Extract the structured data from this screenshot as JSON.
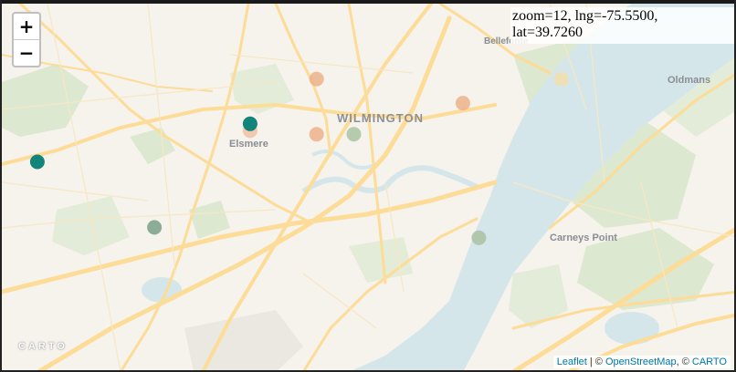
{
  "map": {
    "zoom_in_label": "+",
    "zoom_out_label": "−",
    "info_line1": "zoom=12, lng=-75.5500,",
    "info_line2": "lat=39.7260",
    "places": {
      "wilmington": "WILMINGTON",
      "elsmere": "Elsmere",
      "bellefonte": "Bellefonte",
      "oldmans": "Oldmans",
      "carneys_point": "Carneys Point"
    },
    "basemap_logo": "CARTO",
    "attribution": {
      "leaflet": "Leaflet",
      "sep1": " | © ",
      "osm": "OpenStreetMap",
      "sep2": ", © ",
      "carto": "CARTO"
    },
    "colors": {
      "teal": "#12857b",
      "sage": "#7fa58e",
      "olive": "#a6bf9f",
      "peach": "#ecae85",
      "pale_yellow": "#f4dea6",
      "water": "#d7e7ea",
      "park": "#dce8d0",
      "road": "#fcdc97"
    },
    "markers": [
      {
        "lng": -75.595,
        "lat": 39.744,
        "color": "teal",
        "opacity": 1.0
      },
      {
        "lng": -75.675,
        "lat": 39.733,
        "color": "teal",
        "opacity": 1.0
      },
      {
        "lng": -75.631,
        "lat": 39.714,
        "color": "sage",
        "opacity": 0.9
      },
      {
        "lng": -75.556,
        "lat": 39.741,
        "color": "olive",
        "opacity": 0.8
      },
      {
        "lng": -75.509,
        "lat": 39.711,
        "color": "olive",
        "opacity": 0.8
      },
      {
        "lng": -75.57,
        "lat": 39.757,
        "color": "peach",
        "opacity": 0.8
      },
      {
        "lng": -75.57,
        "lat": 39.741,
        "color": "peach",
        "opacity": 0.8
      },
      {
        "lng": -75.515,
        "lat": 39.75,
        "color": "peach",
        "opacity": 0.8
      },
      {
        "lng": -75.595,
        "lat": 39.742,
        "color": "peach",
        "opacity": 0.6
      },
      {
        "lng": -75.478,
        "lat": 39.757,
        "color": "pale_yellow",
        "opacity": 0.8
      }
    ]
  }
}
